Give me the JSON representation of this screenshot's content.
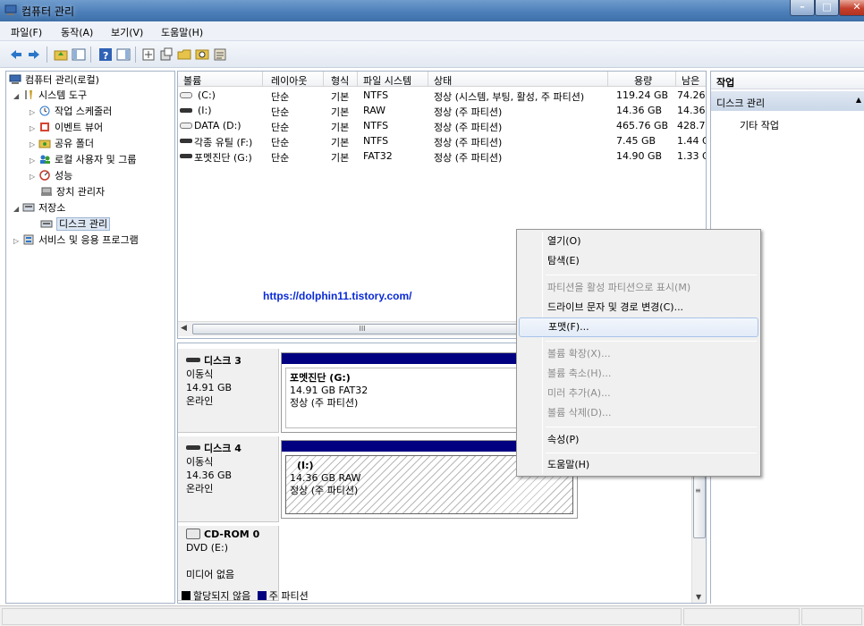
{
  "window": {
    "title": "컴퓨터 관리",
    "app_icon": "computer-management-icon",
    "min": "–",
    "max": "□",
    "close": "✕"
  },
  "menu": [
    "파일(F)",
    "동작(A)",
    "보기(V)",
    "도움말(H)"
  ],
  "toolbar_icons": [
    "back-arrow-icon",
    "forward-arrow-icon",
    "up-folder-icon",
    "show-hide-tree-icon",
    "help-icon",
    "show-hide-action-icon",
    "disk-properties-icon",
    "export-icon",
    "open-folder-icon",
    "search-icon",
    "settings-icon"
  ],
  "tree": {
    "root": "컴퓨터 관리(로컬)",
    "system_tools": "시스템 도구",
    "task_scheduler": "작업 스케줄러",
    "event_viewer": "이벤트 뷰어",
    "shared_folders": "공유 폴더",
    "local_users": "로컬 사용자 및 그룹",
    "performance": "성능",
    "device_manager": "장치 관리자",
    "storage": "저장소",
    "disk_management": "디스크 관리",
    "services": "서비스 및 응용 프로그램"
  },
  "volume_list": {
    "headers": [
      "볼륨",
      "레이아웃",
      "형식",
      "파일 시스템",
      "상태",
      "용량",
      "남은"
    ],
    "rows": [
      [
        "(C:)",
        "단순",
        "기본",
        "NTFS",
        "정상 (시스템, 부팅, 활성, 주 파티션)",
        "119.24 GB",
        "74.26"
      ],
      [
        "(I:)",
        "단순",
        "기본",
        "RAW",
        "정상 (주 파티션)",
        "14.36 GB",
        "14.36"
      ],
      [
        "DATA (D:)",
        "단순",
        "기본",
        "NTFS",
        "정상 (주 파티션)",
        "465.76 GB",
        "428.7"
      ],
      [
        "각종 유틸 (F:)",
        "단순",
        "기본",
        "NTFS",
        "정상 (주 파티션)",
        "7.45 GB",
        "1.44 G"
      ],
      [
        "포멧진단 (G:)",
        "단순",
        "기본",
        "FAT32",
        "정상 (주 파티션)",
        "14.90 GB",
        "1.33 G"
      ]
    ],
    "scroll_grip": "III"
  },
  "watermark": "https://dolphin11.tistory.com/",
  "disks": [
    {
      "name": "디스크 3",
      "type": "이동식",
      "size": "14.91 GB",
      "status": "온라인",
      "volume": {
        "name": "포멧진단  (G:)",
        "detail": "14.91 GB FAT32",
        "state": "정상 (주 파티션)"
      }
    },
    {
      "name": "디스크 4",
      "type": "이동식",
      "size": "14.36 GB",
      "status": "온라인",
      "volume": {
        "name": "(I:)",
        "detail": "14.36 GB RAW",
        "state": "정상 (주 파티션)"
      }
    },
    {
      "name": "CD-ROM 0",
      "type": "DVD (E:)",
      "size": "",
      "status": "미디어 없음"
    }
  ],
  "legend": {
    "unallocated": "할당되지 않음",
    "primary": "주 파티션",
    "unallocated_color": "#000000",
    "primary_color": "#000080"
  },
  "actions": {
    "header": "작업",
    "section": "디스크 관리",
    "more": "기타 작업"
  },
  "context_menu": {
    "open": "열기(O)",
    "explore": "탐색(E)",
    "mark_active": "파티션을 활성 파티션으로 표시(M)",
    "change_letter": "드라이브 문자 및 경로 변경(C)...",
    "format": "포맷(F)...",
    "extend": "볼륨 확장(X)...",
    "shrink": "볼륨 축소(H)...",
    "add_mirror": "미러 추가(A)...",
    "delete": "볼륨 삭제(D)...",
    "properties": "속성(P)",
    "help": "도움말(H)"
  }
}
